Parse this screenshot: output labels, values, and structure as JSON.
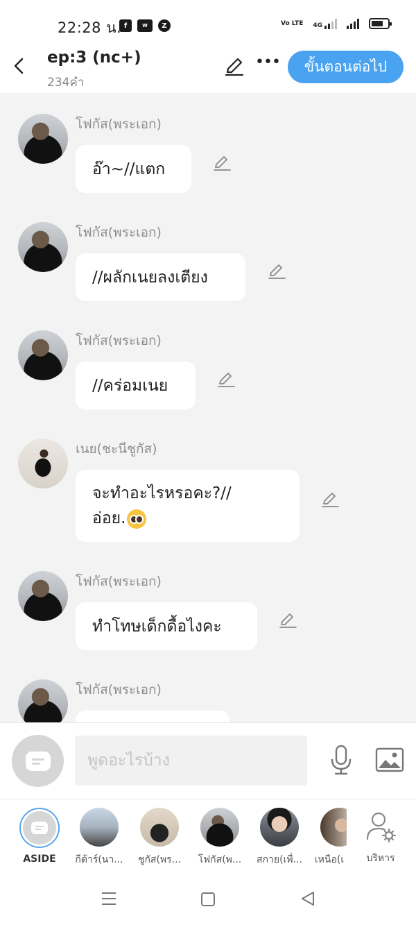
{
  "status_bar": {
    "time": "22:28 น.",
    "app_icons": [
      "facebook-icon",
      "webtoon-icon",
      "z-app-icon"
    ],
    "volte": "Vo LTE",
    "network": "4G",
    "battery_level": 0.72
  },
  "header": {
    "title": "ep:3 (nc+)",
    "word_count": "234คำ",
    "next_button": "ขั้นตอนต่อไป"
  },
  "messages": [
    {
      "sender": "โฟกัส(พระเอก)",
      "lines": [
        "อ๊า~//แตก"
      ],
      "avatar": "focus"
    },
    {
      "sender": "โฟกัส(พระเอก)",
      "lines": [
        "//ผลักเนยลงเตียง"
      ],
      "avatar": "focus"
    },
    {
      "sender": "โฟกัส(พระเอก)",
      "lines": [
        "//คร่อมเนย"
      ],
      "avatar": "focus"
    },
    {
      "sender": "เนย(ชะนีชูกัส)",
      "lines": [
        "จะทำอะไรหรอคะ?//",
        "อ่อย."
      ],
      "emoji": "pleading-face-emoji",
      "avatar": "noey"
    },
    {
      "sender": "โฟกัส(พระเอก)",
      "lines": [
        "ทำโทษเด็กดื้อไงคะ"
      ],
      "avatar": "focus"
    },
    {
      "sender": "โฟกัส(พระเอก)",
      "lines": [
        ""
      ],
      "avatar": "focus"
    }
  ],
  "input": {
    "placeholder": "พูดอะไรบ้าง"
  },
  "characters": [
    {
      "label": "ASIDE",
      "selected": true
    },
    {
      "label": "กีต้าร์(นา..."
    },
    {
      "label": "ชูกัส(พร..."
    },
    {
      "label": "โฟกัส(พ..."
    },
    {
      "label": "สกาย(เพื่..."
    },
    {
      "label": "เหนือ(เ"
    },
    {
      "label": "บริหาร"
    }
  ]
}
